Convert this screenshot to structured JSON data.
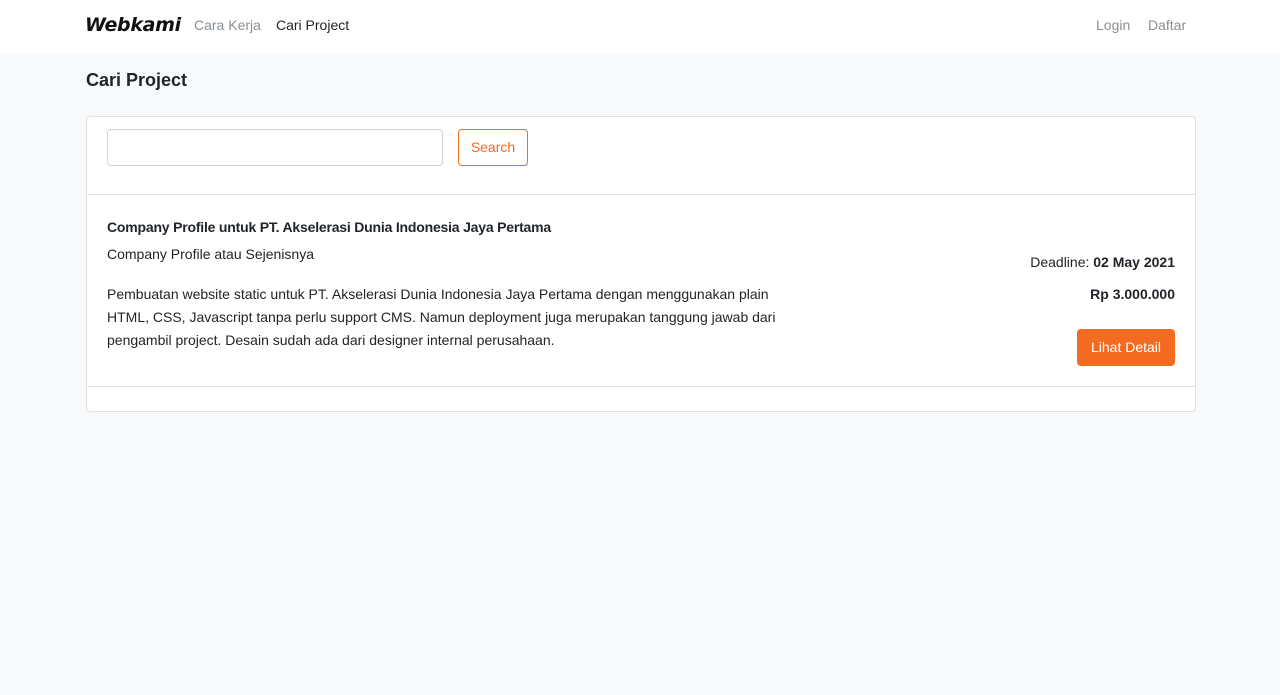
{
  "nav": {
    "brand": "Webkami",
    "links": [
      "Cara Kerja",
      "Cari Project"
    ],
    "auth": [
      "Login",
      "Daftar"
    ]
  },
  "page": {
    "title": "Cari Project"
  },
  "search": {
    "value": "",
    "placeholder": "",
    "button_label": "Search"
  },
  "projects": [
    {
      "title": "Company Profile untuk PT. Akselerasi Dunia Indonesia Jaya Pertama",
      "category": "Company Profile atau Sejenisnya",
      "description": "Pembuatan website static untuk PT. Akselerasi Dunia Indonesia Jaya Pertama dengan menggunakan plain HTML, CSS, Javascript tanpa perlu support CMS. Namun deployment juga merupakan tanggung jawab dari pengambil project. Desain sudah ada dari designer internal perusahaan.",
      "deadline_label": "Deadline: ",
      "deadline": "02 May 2021",
      "price": "Rp 3.000.000",
      "button_label": "Lihat Detail"
    }
  ],
  "colors": {
    "accent": "#f26b21",
    "background": "#f8f9fa"
  }
}
